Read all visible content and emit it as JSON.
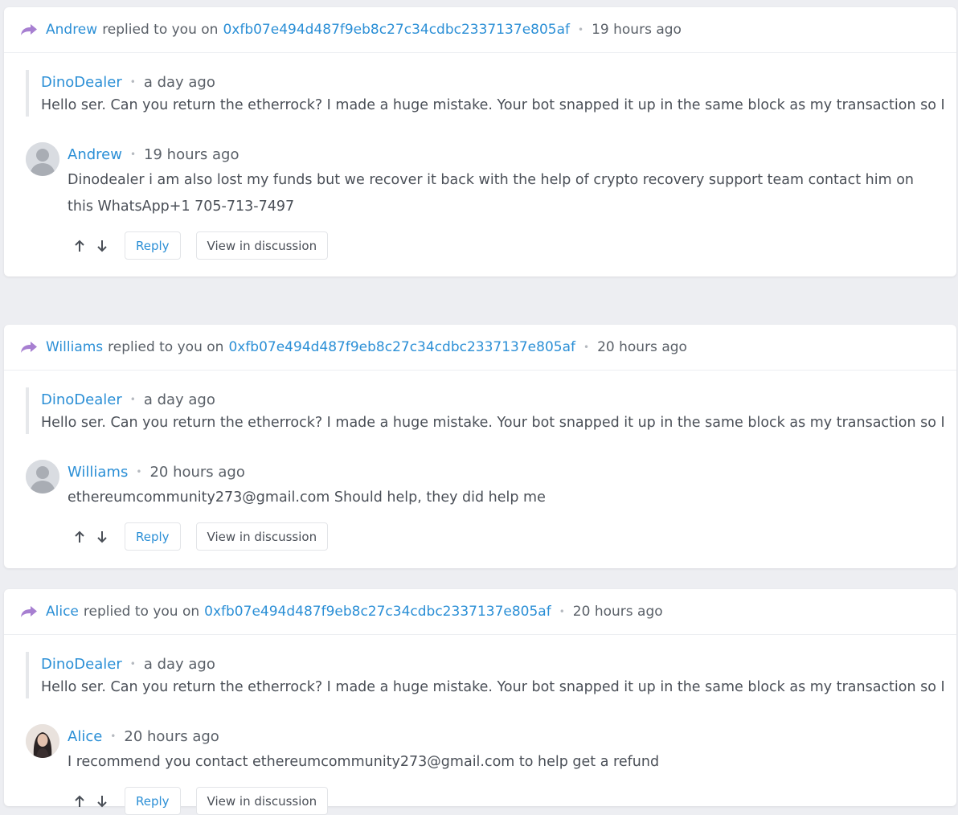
{
  "notifications": [
    {
      "author": "Andrew",
      "action_text": "replied to you on",
      "target": "0xfb07e494d487f9eb8c27c34cdbc2337137e805af",
      "time": "19 hours ago",
      "quote": {
        "author": "DinoDealer",
        "time": "a day ago",
        "text": "Hello ser. Can you return the etherrock? I made a huge mistake. Your bot snapped it up in the same block as my transaction so I ..."
      },
      "reply": {
        "author": "Andrew",
        "time": "19 hours ago",
        "text": "Dinodealer i am also lost my funds but we recover it back with the help of crypto recovery support team contact him on this WhatsApp+1 705-713-7497",
        "avatar": "default-avatar-icon"
      },
      "reply_label": "Reply",
      "view_label": "View in discussion"
    },
    {
      "author": "Williams",
      "action_text": "replied to you on",
      "target": "0xfb07e494d487f9eb8c27c34cdbc2337137e805af",
      "time": "20 hours ago",
      "quote": {
        "author": "DinoDealer",
        "time": "a day ago",
        "text": "Hello ser. Can you return the etherrock? I made a huge mistake. Your bot snapped it up in the same block as my transaction so I ..."
      },
      "reply": {
        "author": "Williams",
        "time": "20 hours ago",
        "text": "ethereumcommunity273@gmail.com Should help, they did help me",
        "avatar": "default-avatar-icon"
      },
      "reply_label": "Reply",
      "view_label": "View in discussion"
    },
    {
      "author": "Alice",
      "action_text": "replied to you on",
      "target": "0xfb07e494d487f9eb8c27c34cdbc2337137e805af",
      "time": "20 hours ago",
      "quote": {
        "author": "DinoDealer",
        "time": "a day ago",
        "text": "Hello ser. Can you return the etherrock? I made a huge mistake. Your bot snapped it up in the same block as my transaction so I ..."
      },
      "reply": {
        "author": "Alice",
        "time": "20 hours ago",
        "text": "I recommend you contact ethereumcommunity273@gmail.com to help get a refund",
        "avatar": "photo-avatar"
      },
      "reply_label": "Reply",
      "view_label": "View in discussion"
    }
  ],
  "colors": {
    "link": "#2b8fd6",
    "reply_icon": "#a77fd1",
    "background": "#edeef2"
  }
}
